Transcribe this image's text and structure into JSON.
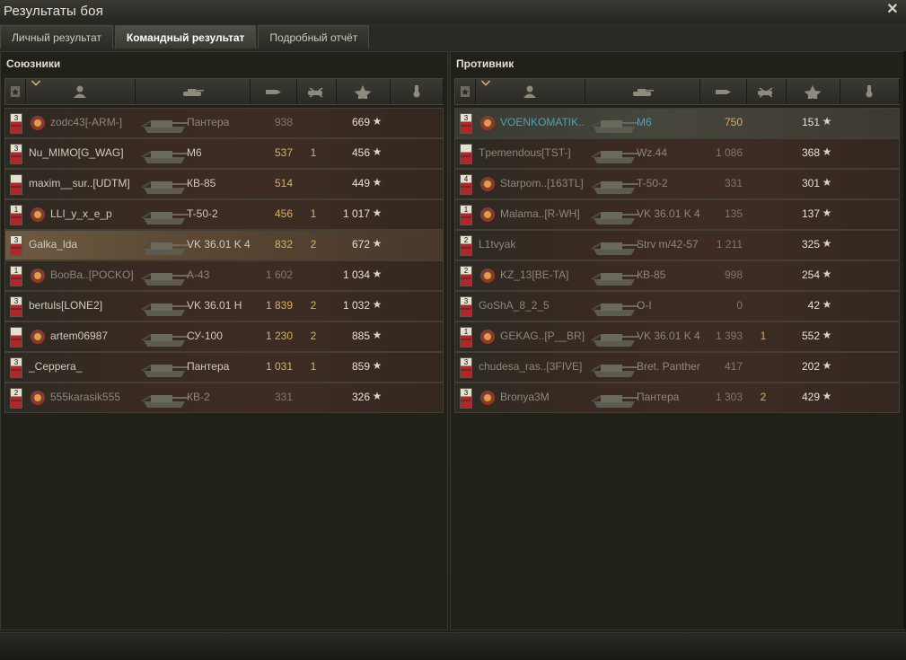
{
  "window": {
    "title": "Результаты боя",
    "close_icon": "close-icon"
  },
  "tabs": [
    {
      "label": "Личный результат",
      "active": false
    },
    {
      "label": "Командный результат",
      "active": true
    },
    {
      "label": "Подробный отчёт",
      "active": false
    }
  ],
  "allies": {
    "title": "Союзники",
    "rows": [
      {
        "level": "3",
        "name": "zodc43[-ARM-]",
        "tank": "Пантера",
        "damage": "938",
        "kills": "",
        "xp": "669",
        "style": "dead",
        "clan": true
      },
      {
        "level": "3",
        "name": "Nu_MIMO[G_WAG]",
        "tank": "M6",
        "damage": "537",
        "kills": "1",
        "xp": "456",
        "style": "alive",
        "clan": false
      },
      {
        "level": "",
        "name": "maxim__sur..[UDTM]",
        "tank": "КВ-85",
        "damage": "514",
        "kills": "",
        "xp": "449",
        "style": "alive",
        "clan": false
      },
      {
        "level": "1",
        "name": "LLI_y_x_e_p",
        "tank": "T-50-2",
        "damage": "456",
        "kills": "1",
        "xp": "1 017",
        "style": "alive",
        "clan": true
      },
      {
        "level": "3",
        "name": "Galka_lda",
        "tank": "VK 36.01 K 4",
        "damage": "832",
        "kills": "2",
        "xp": "672",
        "style": "highlight",
        "clan": false
      },
      {
        "level": "1",
        "name": "BooBa..[POCKO]",
        "tank": "A-43",
        "damage": "1 602",
        "kills": "",
        "xp": "1 034",
        "style": "dead",
        "clan": true
      },
      {
        "level": "3",
        "name": "bertuls[LONE2]",
        "tank": "VK 36.01 H",
        "damage": "1 839",
        "kills": "2",
        "xp": "1 032",
        "style": "alive",
        "clan": false
      },
      {
        "level": "",
        "name": "artem06987",
        "tank": "СУ-100",
        "damage": "1 230",
        "kills": "2",
        "xp": "885",
        "style": "alive",
        "clan": true
      },
      {
        "level": "3",
        "name": "_Ceppera_",
        "tank": "Пантера",
        "damage": "1 031",
        "kills": "1",
        "xp": "859",
        "style": "alive",
        "clan": false
      },
      {
        "level": "2",
        "name": "555karasik555",
        "tank": "КВ-2",
        "damage": "331",
        "kills": "",
        "xp": "326",
        "style": "dead",
        "clan": true
      }
    ]
  },
  "enemies": {
    "title": "Противник",
    "rows": [
      {
        "level": "3",
        "name": "VOENKOMATIK..",
        "tank": "M6",
        "damage": "750",
        "kills": "",
        "xp": "151",
        "style": "self",
        "clan": true
      },
      {
        "level": "",
        "name": "Tpemendous[TST-]",
        "tank": "Wz.44",
        "damage": "1 086",
        "kills": "",
        "xp": "368",
        "style": "dead",
        "clan": false
      },
      {
        "level": "4",
        "name": "Starpom..[163TL]",
        "tank": "T-50-2",
        "damage": "331",
        "kills": "",
        "xp": "301",
        "style": "dead",
        "clan": true
      },
      {
        "level": "1",
        "name": "Malama..[R-WH]",
        "tank": "VK 36.01 K 4",
        "damage": "135",
        "kills": "",
        "xp": "137",
        "style": "dead",
        "clan": true
      },
      {
        "level": "2",
        "name": "L1tvyak",
        "tank": "Strv m/42-57",
        "damage": "1 211",
        "kills": "",
        "xp": "325",
        "style": "dead",
        "clan": false
      },
      {
        "level": "2",
        "name": "KZ_13[BE-TA]",
        "tank": "КВ-85",
        "damage": "998",
        "kills": "",
        "xp": "254",
        "style": "dead",
        "clan": true
      },
      {
        "level": "3",
        "name": "GoShA_8_2_5",
        "tank": "O-I",
        "damage": "0",
        "kills": "",
        "xp": "42",
        "style": "dead",
        "clan": false
      },
      {
        "level": "1",
        "name": "GEKAG..[P__BR]",
        "tank": "VK 36.01 K 4",
        "damage": "1 393",
        "kills": "1",
        "xp": "552",
        "style": "dead",
        "clan": true
      },
      {
        "level": "3",
        "name": "chudesa_ras..[3FIVE]",
        "tank": "Bret. Panther",
        "damage": "417",
        "kills": "",
        "xp": "202",
        "style": "dead",
        "clan": false
      },
      {
        "level": "3",
        "name": "Bronya3M",
        "tank": "Пантера",
        "damage": "1 303",
        "kills": "2",
        "xp": "429",
        "style": "dead",
        "clan": true
      }
    ]
  },
  "colors": {
    "self_name": "#4aa3b5",
    "damage": "#d7b25e",
    "level_band": "#b4252a"
  },
  "icons": {
    "header": [
      "squad-icon",
      "sort-chevron-icon",
      "player-icon",
      "tank-icon",
      "damage-icon",
      "kills-icon",
      "xp-star-icon",
      "medal-icon"
    ]
  }
}
